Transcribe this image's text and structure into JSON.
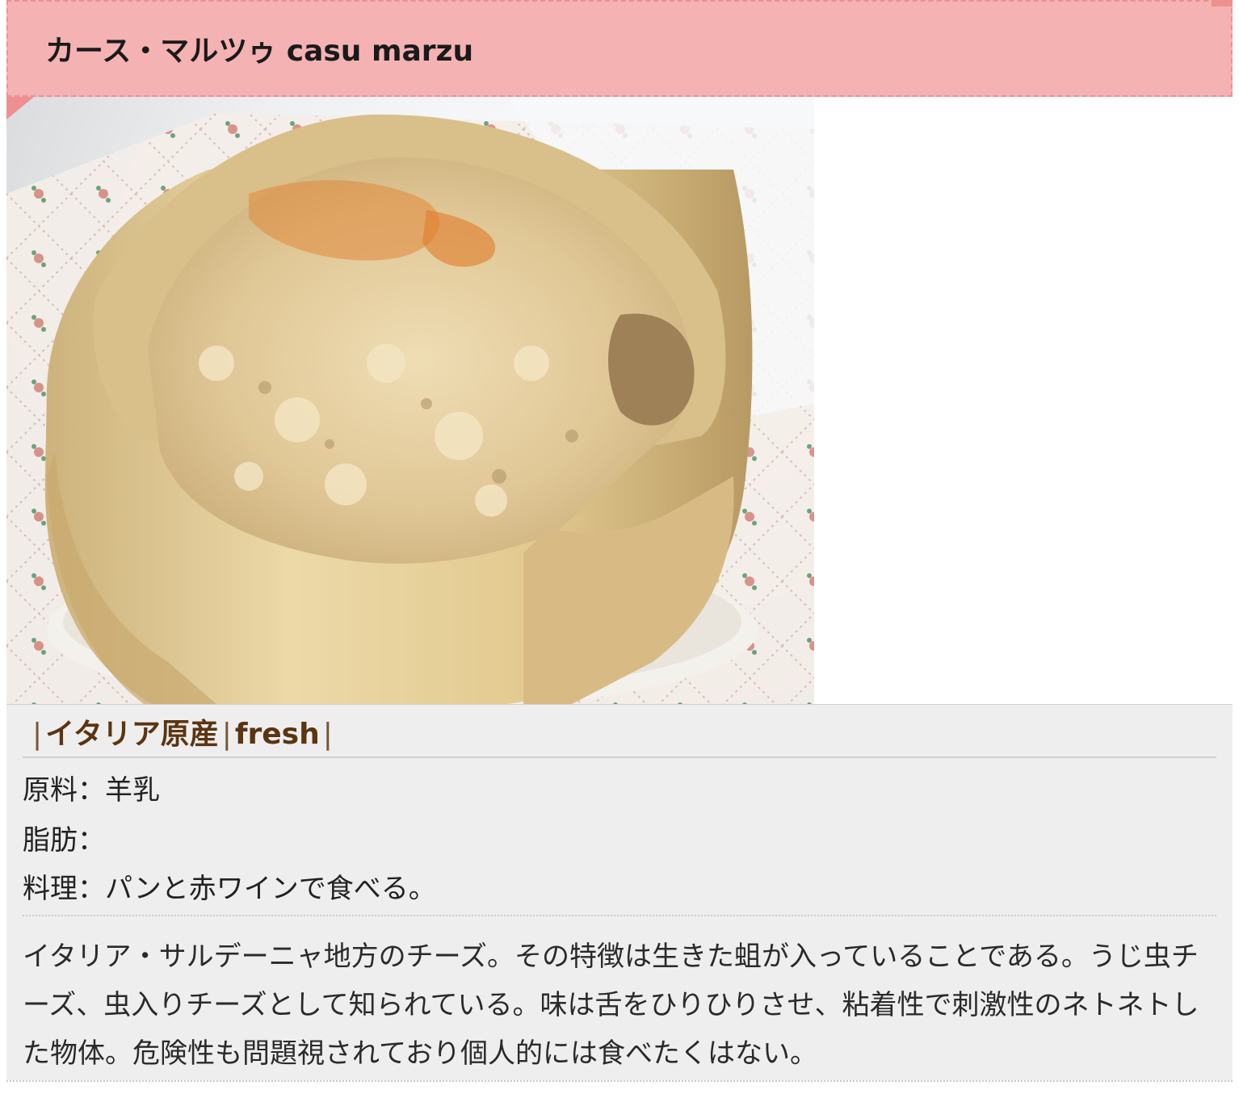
{
  "article": {
    "heading": "カース・マルツゥ casu marzu",
    "photo": {
      "subject": "casu-marzu-cheese-photo"
    },
    "tags": {
      "separator": "|",
      "origin": "イタリア原産",
      "type": "fresh"
    },
    "specs": [
      {
        "text": "原料：羊乳"
      },
      {
        "text": "脂肪："
      },
      {
        "text": "料理：パンと赤ワインで食べる。"
      }
    ],
    "description": "イタリア・サルデーニャ地方のチーズ。その特徴は生きた蛆が入っていることである。うじ虫チーズ、虫入りチーズとして知られている。味は舌をひりひりさせ、粘着性で刺激性のネトネトした物体。危険性も問題視されており個人的には食べたくはない。"
  },
  "colors": {
    "heading_bg": "#f4b2b3",
    "heading_border": "#ee8f90",
    "panel_bg": "#eeeeee",
    "tag_text": "#5b3411"
  }
}
